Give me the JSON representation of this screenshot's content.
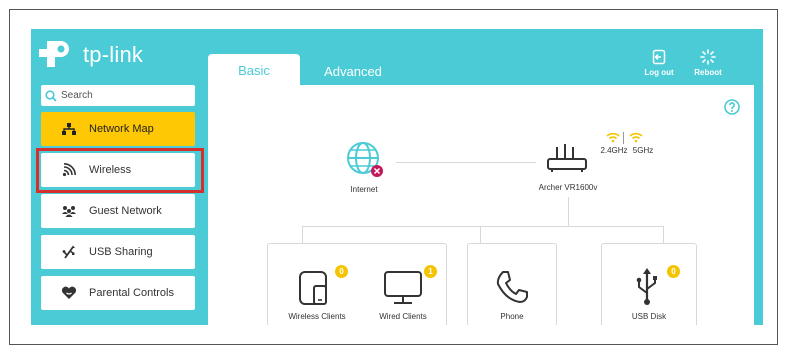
{
  "brand": {
    "name": "tp-link"
  },
  "tabs": {
    "basic": "Basic",
    "advanced": "Advanced"
  },
  "header_actions": {
    "logout": "Log out",
    "reboot": "Reboot"
  },
  "search": {
    "placeholder": "Search"
  },
  "sidebar": {
    "items": [
      {
        "label": "Network Map",
        "icon": "network-map-icon",
        "active": true
      },
      {
        "label": "Wireless",
        "icon": "wireless-icon",
        "active": false
      },
      {
        "label": "Guest Network",
        "icon": "guest-network-icon",
        "active": false
      },
      {
        "label": "USB Sharing",
        "icon": "usb-sharing-icon",
        "active": false
      },
      {
        "label": "Parental Controls",
        "icon": "parental-controls-icon",
        "active": false
      }
    ]
  },
  "network_map": {
    "internet_label": "Internet",
    "router_label": "Archer VR1600v",
    "band_24": "2.4GHz",
    "band_5": "5GHz",
    "devices": [
      {
        "label": "Wireless Clients",
        "count": "0"
      },
      {
        "label": "Wired Clients",
        "count": "1"
      },
      {
        "label": "Phone"
      },
      {
        "label": "USB Disk",
        "count": "0"
      }
    ]
  },
  "colors": {
    "primary": "#4acbd6",
    "accent": "#ffc805",
    "badge": "#f5c400",
    "error": "#c2185b",
    "highlight": "#d32f2f"
  }
}
